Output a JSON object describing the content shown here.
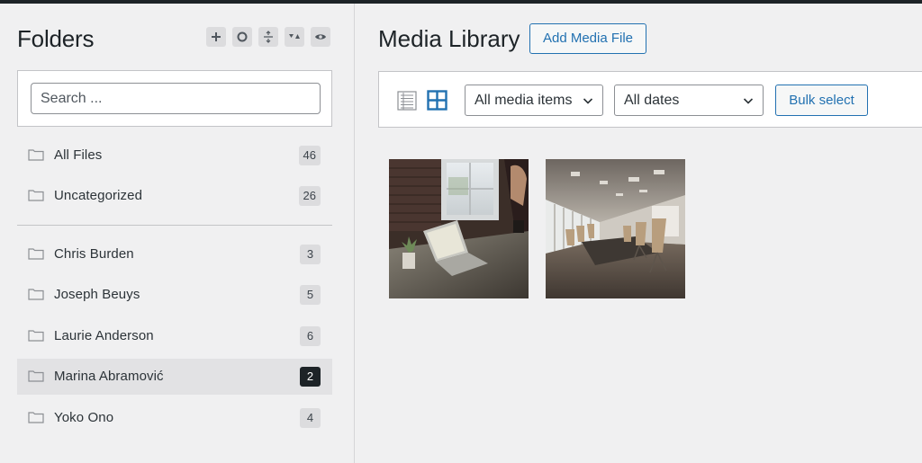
{
  "sidebar": {
    "title": "Folders",
    "search": {
      "placeholder": "Search ...",
      "value": ""
    },
    "tools": [
      "add-folder-icon",
      "circle-icon",
      "collapse-expand-icon",
      "sort-icon",
      "eye-icon"
    ],
    "top_folders": [
      {
        "label": "All Files",
        "count": "46"
      },
      {
        "label": "Uncategorized",
        "count": "26"
      }
    ],
    "folders": [
      {
        "label": "Chris Burden",
        "count": "3"
      },
      {
        "label": "Joseph Beuys",
        "count": "5"
      },
      {
        "label": "Laurie Anderson",
        "count": "6"
      },
      {
        "label": "Marina Abramović",
        "count": "2",
        "active": true
      },
      {
        "label": "Yoko Ono",
        "count": "4"
      }
    ]
  },
  "main": {
    "title": "Media Library",
    "add_button": "Add Media File",
    "toolbar": {
      "view_modes": [
        "list-view-icon",
        "grid-view-icon"
      ],
      "active_view": "grid",
      "media_filter": "All media items",
      "date_filter": "All dates",
      "bulk_select": "Bulk select"
    },
    "media_items": [
      {
        "name": "laptop-workspace-photo"
      },
      {
        "name": "conference-room-photo"
      }
    ]
  },
  "colors": {
    "accent": "#2271b1",
    "background": "#f0f0f1",
    "active_badge": "#1d2327"
  }
}
